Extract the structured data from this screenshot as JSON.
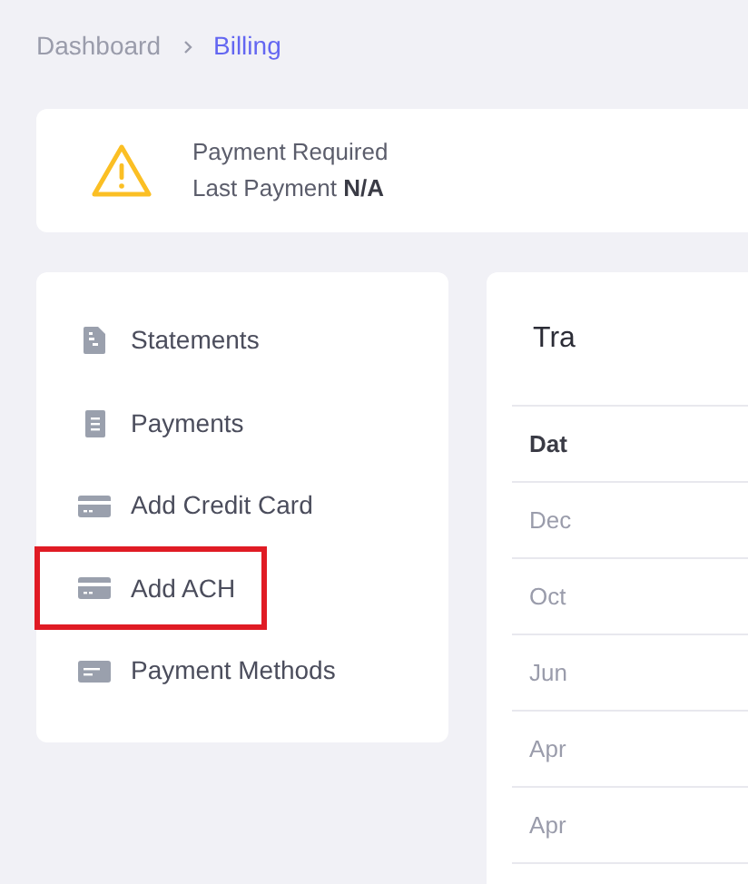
{
  "breadcrumb": [
    {
      "label": "Dashboard",
      "selected": false
    },
    {
      "label": "Billing",
      "selected": true
    }
  ],
  "alert": {
    "title": "Payment Required",
    "last_payment_label": "Last Payment",
    "last_payment_value": "N/A"
  },
  "menu": [
    {
      "label": "Statements",
      "kind": "statement",
      "highlighted": false
    },
    {
      "label": "Payments",
      "kind": "receipt",
      "highlighted": false
    },
    {
      "label": "Add Credit Card",
      "kind": "card",
      "highlighted": false
    },
    {
      "label": "Add ACH",
      "kind": "card",
      "highlighted": true
    },
    {
      "label": "Payment Methods",
      "kind": "methods",
      "highlighted": false
    }
  ],
  "transactions": {
    "title": "Tra",
    "header": "Dat",
    "rows": [
      "Dec",
      "Oct",
      "Jun",
      "Apr",
      "Apr"
    ]
  }
}
